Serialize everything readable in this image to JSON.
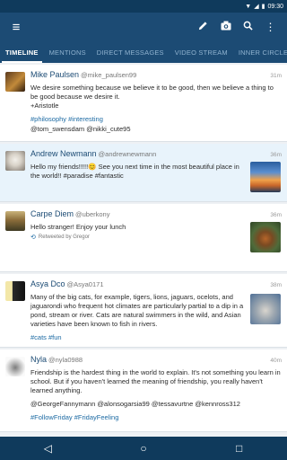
{
  "status": {
    "time": "09:30"
  },
  "tabs": [
    {
      "label": "TIMELINE",
      "active": true
    },
    {
      "label": "MENTIONS"
    },
    {
      "label": "DIRECT MESSAGES"
    },
    {
      "label": "VIDEO STREAM"
    },
    {
      "label": "INNER CIRCLE"
    }
  ],
  "tweets": [
    {
      "name": "Mike Paulsen",
      "handle": "@mike_paulsen99",
      "time": "31m",
      "text": "We desire something because we believe it to be good, then we believe a thing to be good because we desire it.",
      "text2": "+Aristotle",
      "tags": "#philosophy #interesting",
      "tags2": "@tom_swensdam @nikki_cute95"
    },
    {
      "name": "Andrew Newmann",
      "handle": "@andrewnewmann",
      "time": "36m",
      "text": "Hello my friends!!!!!😊 See you next time in the most beautiful place in the world!! #paradise #fantastic"
    },
    {
      "name": "Carpe Diem",
      "handle": "@uberkony",
      "time": "36m",
      "text": "Hello stranger! Enjoy your lunch",
      "retweet": "Retweeted by Gregor"
    },
    {
      "name": "Asya Dco",
      "handle": "@Asya0171",
      "time": "38m",
      "text": "Many of the big cats, for example, tigers, lions, jaguars, ocelots, and jaguarondi who frequent hot climates are particularly partial to a dip in a pond, stream or river.  Cats are natural swimmers in the wild, and Asian varieties have been known to fish in rivers.",
      "tags": "#cats #fun"
    },
    {
      "name": "Nyla",
      "handle": "@nyla0988",
      "time": "40m",
      "text": "Friendship is the hardest thing in the world to explain. It's not something you learn in school. But if you haven't learned the meaning of friendship, you really haven't learned anything.",
      "mentions": "@GeorgeFannymann @alonsogarsia99 @tessavurtne @kennross312",
      "tags": "#FollowFriday #FridayFeeling"
    }
  ],
  "colors": {
    "primary": "#1c4b74",
    "status": "#0f3a5c",
    "link": "#1c6aa3",
    "highlight": "#e8f3fb"
  }
}
